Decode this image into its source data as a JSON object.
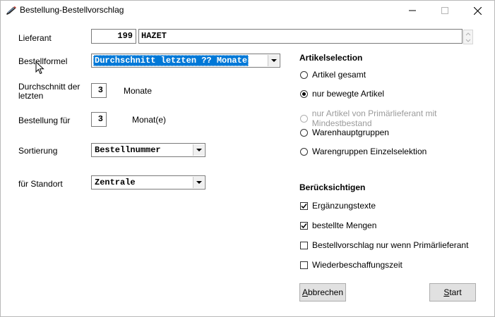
{
  "window": {
    "title": "Bestellung-Bestellvorschlag"
  },
  "form": {
    "lieferant_label": "Lieferant",
    "lieferant_nr": "199",
    "lieferant_name": "HAZET",
    "bestellformel_label": "Bestellformel",
    "bestellformel_value": "Durchschnitt letzten ?? Monate",
    "durchschnitt_label_1": "Durchschnitt der",
    "durchschnitt_label_2": "letzten",
    "durchschnitt_value": "3",
    "durchschnitt_unit": "Monate",
    "bestellung_fuer_label": "Bestellung für",
    "bestellung_fuer_value": "3",
    "bestellung_fuer_unit": "Monat(e)",
    "sortierung_label": "Sortierung",
    "sortierung_value": "Bestellnummer",
    "standort_label": "für Standort",
    "standort_value": "Zentrale"
  },
  "artikelselection": {
    "heading": "Artikelselection",
    "options": [
      {
        "label": "Artikel gesamt",
        "selected": false,
        "enabled": true
      },
      {
        "label": "nur bewegte Artikel",
        "selected": true,
        "enabled": true
      },
      {
        "label": "nur Artikel von Primärlieferant mit Mindestbestand",
        "selected": false,
        "enabled": false
      },
      {
        "label": "Warenhauptgruppen",
        "selected": false,
        "enabled": true
      },
      {
        "label": "Warengruppen Einzelselektion",
        "selected": false,
        "enabled": true
      }
    ]
  },
  "beruecksichtigen": {
    "heading": "Berücksichtigen",
    "options": [
      {
        "label": "Ergänzungstexte",
        "checked": true
      },
      {
        "label": "bestellte Mengen",
        "checked": true
      },
      {
        "label": "Bestellvorschlag nur wenn Primärlieferant",
        "checked": false
      },
      {
        "label": "Wiederbeschaffungszeit",
        "checked": false
      }
    ]
  },
  "buttons": {
    "abbrechen": "Abbrechen",
    "start": "Start"
  }
}
